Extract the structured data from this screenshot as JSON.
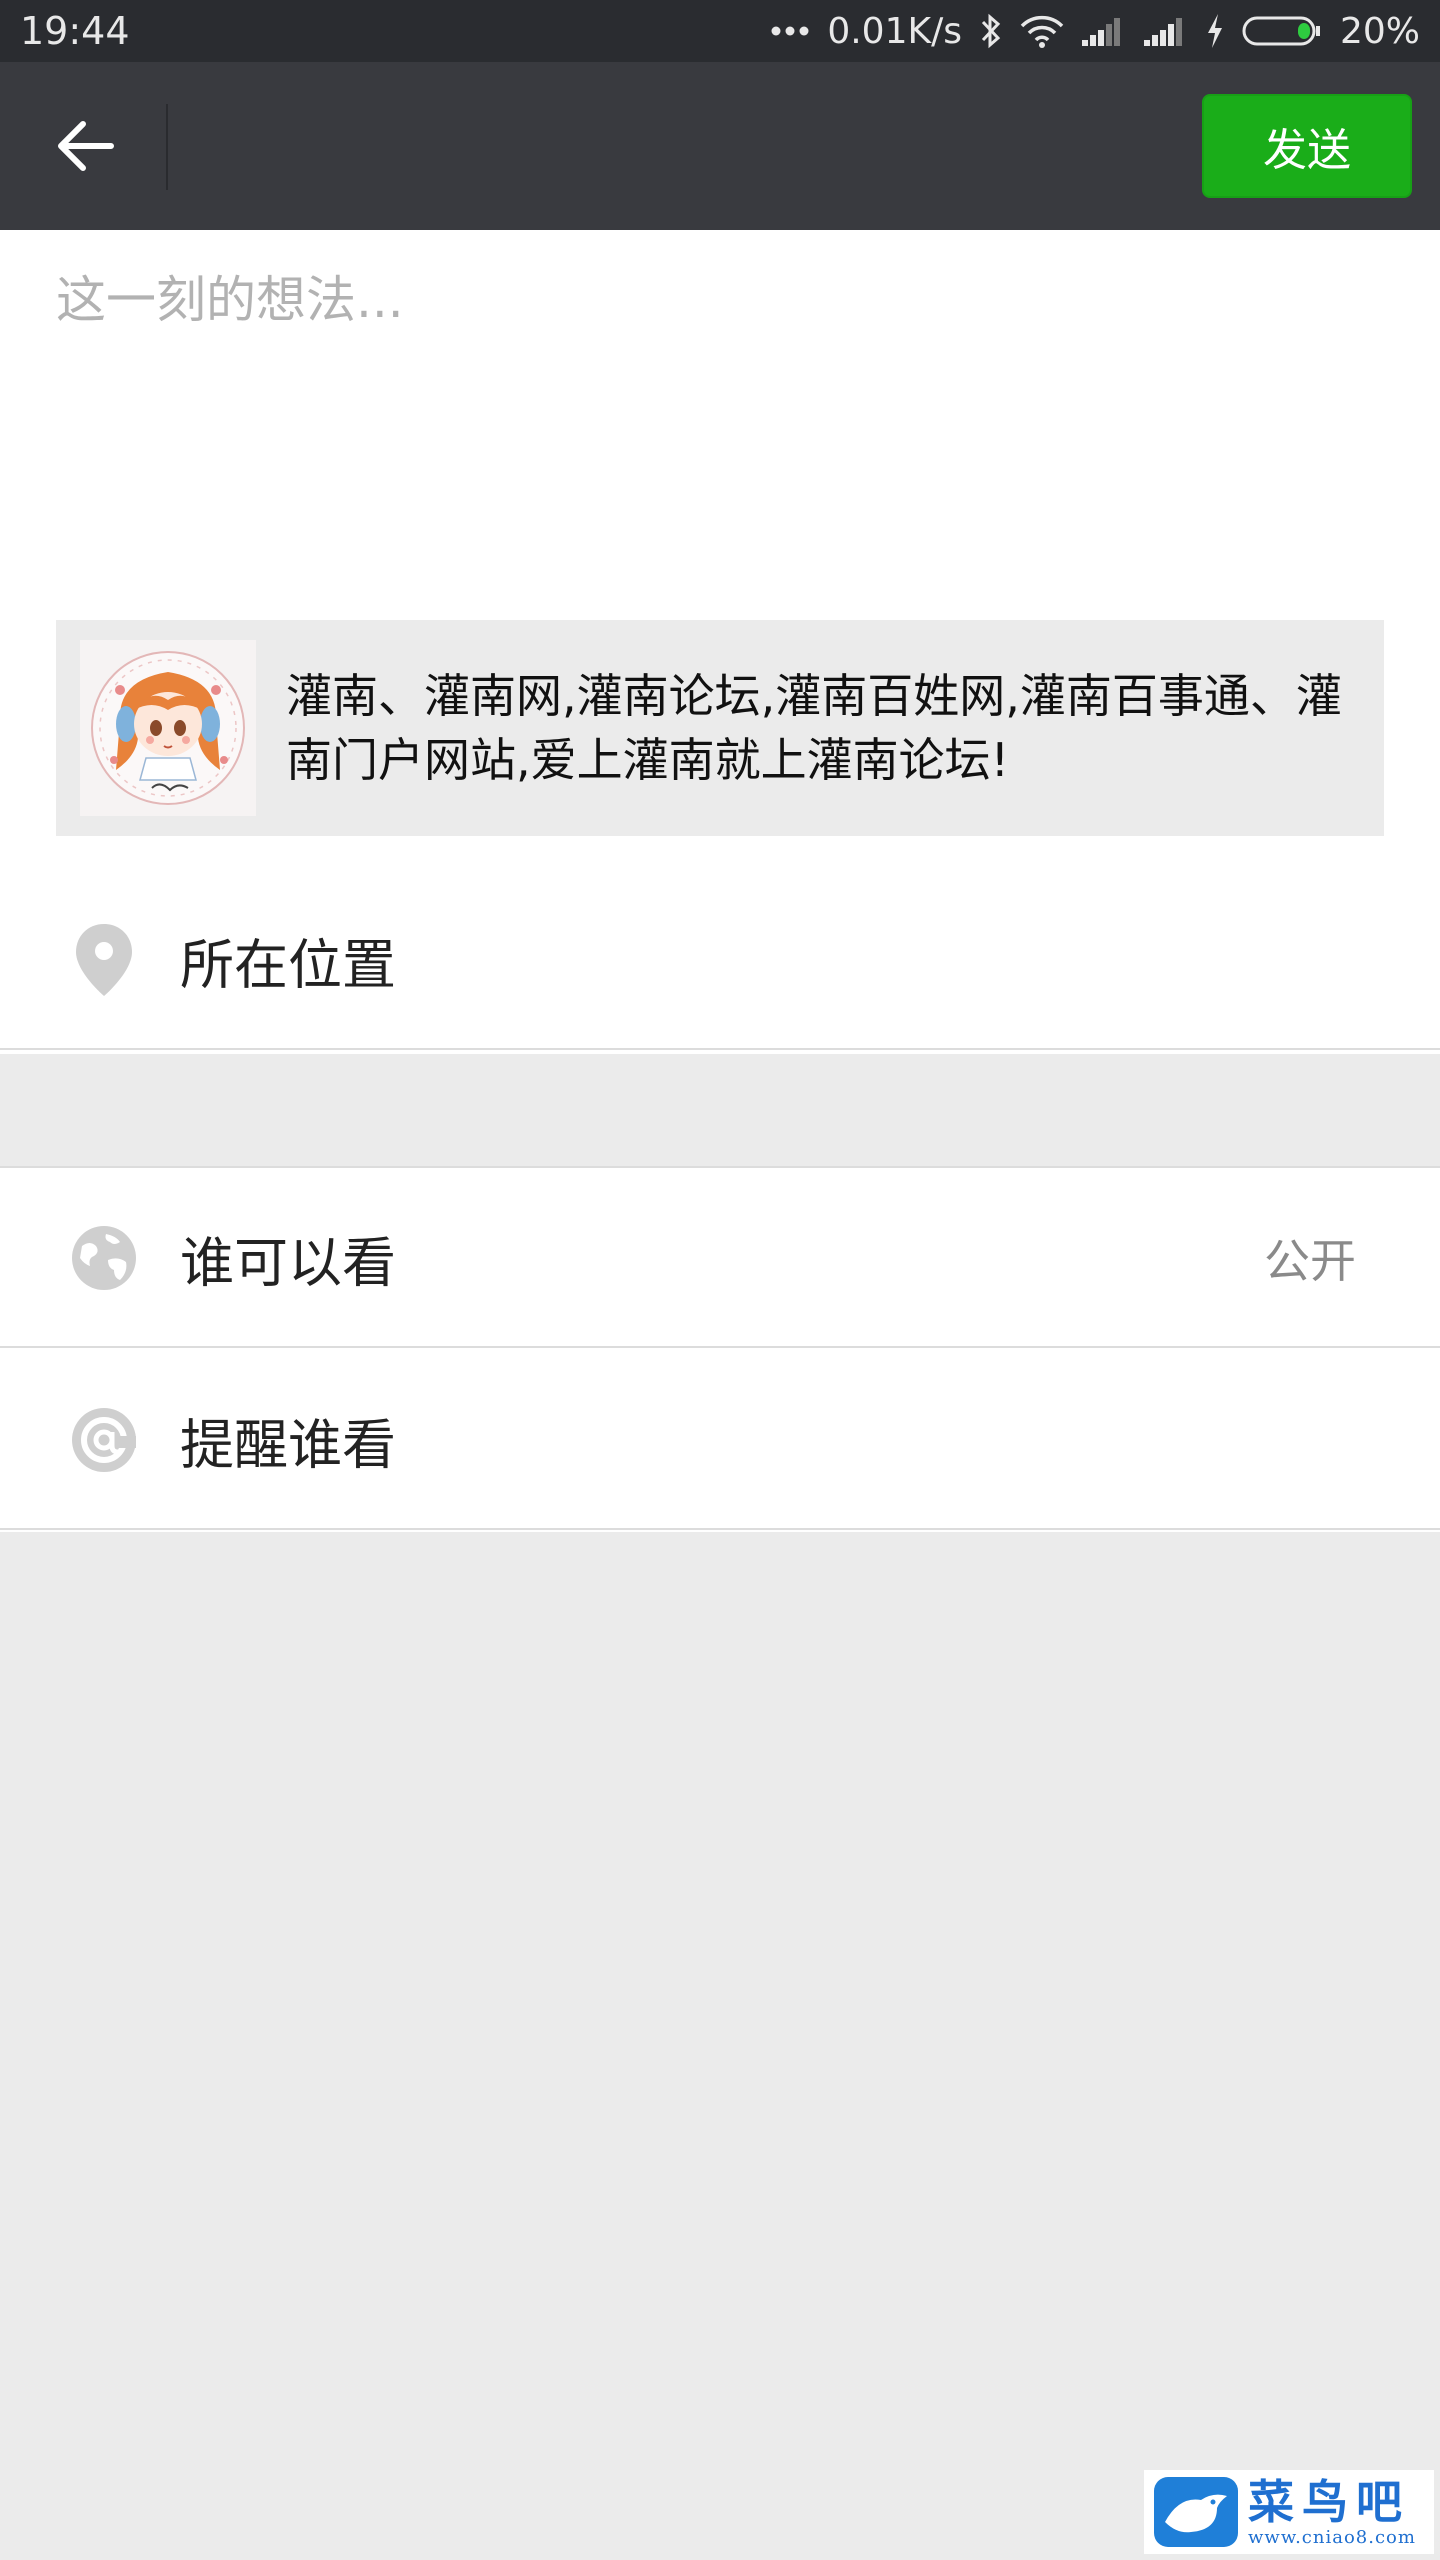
{
  "status_bar": {
    "time": "19:44",
    "network_speed": "0.01K/s",
    "battery": "20%",
    "icons": [
      "more-dots-icon",
      "bluetooth-icon",
      "wifi-icon",
      "signal-icon",
      "signal-icon",
      "charging-icon",
      "battery-icon"
    ]
  },
  "toolbar": {
    "back_icon": "arrow-left-icon",
    "send_label": "发送"
  },
  "composer": {
    "placeholder": "这一刻的想法...",
    "value": ""
  },
  "link_card": {
    "thumbnail_icon": "cartoon-girl-avatar",
    "text": "灌南、灌南网,灌南论坛,灌南百姓网,灌南百事通、灌南门户网站,爱上灌南就上灌南论坛!"
  },
  "location": {
    "icon": "location-pin-icon",
    "label": "所在位置"
  },
  "visibility": {
    "icon": "globe-icon",
    "label": "谁可以看",
    "value": "公开"
  },
  "remind": {
    "icon": "at-sign-icon",
    "label": "提醒谁看"
  },
  "watermark": {
    "title": "菜鸟吧",
    "url": "www.cniao8.com"
  },
  "colors": {
    "toolbar": "#393a3f",
    "status_bar": "#2a2c30",
    "send_button": "#1aad19",
    "background": "#ebebeb",
    "icon_gray": "#c8c8c8"
  }
}
